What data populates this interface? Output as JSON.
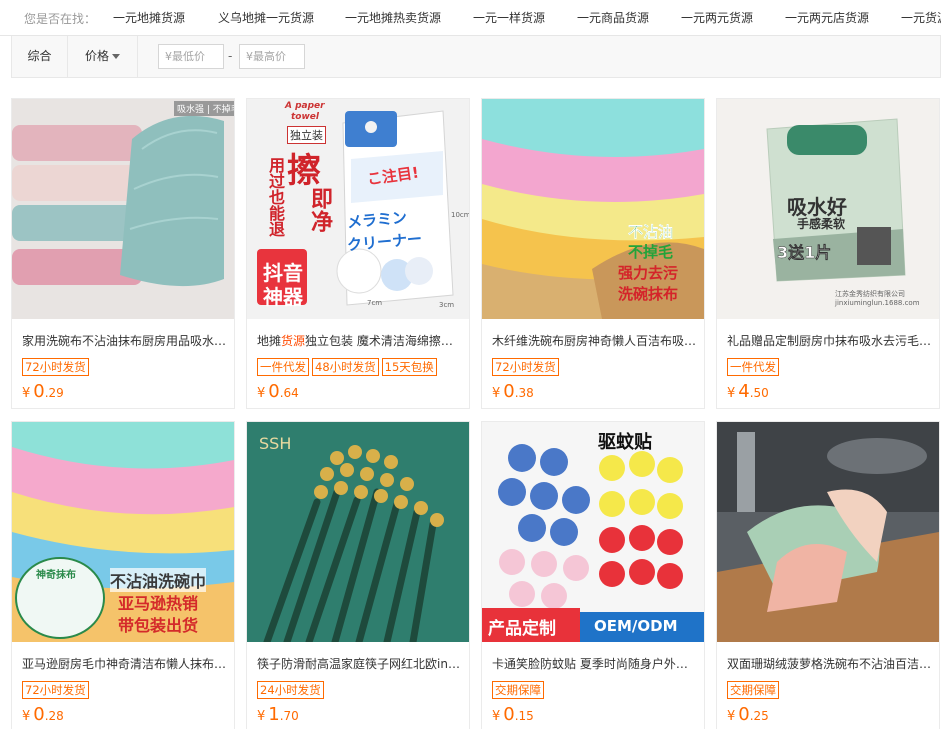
{
  "suggestions": {
    "label": "您是否在找：",
    "terms": [
      "一元地摊货源",
      "义乌地摊一元货源",
      "一元地摊热卖货源",
      "一元一样货源",
      "一元商品货源",
      "一元两元货源",
      "一元两元店货源",
      "一元货源"
    ]
  },
  "filter": {
    "sort_default": "综合",
    "sort_price": "价格",
    "min_price_placeholder": "¥最低价",
    "max_price_placeholder": "¥最高价",
    "separator": "-"
  },
  "products": [
    {
      "title": "家用洗碗布不沾油抹布厨房用品吸水…",
      "title_pre": "",
      "title_hl": "",
      "title_post": "",
      "tags": [
        "72小时发货"
      ],
      "currency": "¥",
      "price_int": "0",
      "price_dec": ".29",
      "image_text": [
        "吸水强 | 不掉毛"
      ]
    },
    {
      "title": "",
      "title_pre": "地摊",
      "title_hl": "货源",
      "title_post": "独立包装 魔术清洁海绵擦…",
      "tags": [
        "一件代发",
        "48小时发货",
        "15天包换"
      ],
      "currency": "¥",
      "price_int": "0",
      "price_dec": ".64",
      "image_text": [
        "A paper",
        "towel",
        "独立装",
        "擦",
        "即净",
        "用过也能退",
        "抖音",
        "神器",
        "こ注目!",
        "メラミン",
        "クリーナー",
        "10cm",
        "7cm",
        "3cm"
      ]
    },
    {
      "title": "木纤维洗碗布厨房神奇懒人百洁布吸…",
      "title_pre": "",
      "title_hl": "",
      "title_post": "",
      "tags": [
        "72小时发货"
      ],
      "currency": "¥",
      "price_int": "0",
      "price_dec": ".38",
      "image_text": [
        "不沾油",
        "不掉毛",
        "强力去污",
        "洗碗抹布"
      ]
    },
    {
      "title": "礼品赠品定制厨房巾抹布吸水去污毛…",
      "title_pre": "",
      "title_hl": "",
      "title_post": "",
      "tags": [
        "一件代发"
      ],
      "currency": "¥",
      "price_int": "4",
      "price_dec": ".50",
      "image_text": [
        "吸水好",
        "手感柔软",
        "3送1片",
        "江苏金秀纺织有限公司",
        "jinxiuminglun.1688.com"
      ]
    },
    {
      "title": "亚马逊厨房毛巾神奇清洁布懒人抹布…",
      "title_pre": "",
      "title_hl": "",
      "title_post": "",
      "tags": [
        "72小时发货"
      ],
      "currency": "¥",
      "price_int": "0",
      "price_dec": ".28",
      "image_text": [
        "不沾油洗碗巾",
        "亚马逊热销",
        "带包装出货",
        "神奇抹布"
      ]
    },
    {
      "title": "筷子防滑耐高温家庭筷子网红北欧in…",
      "title_pre": "",
      "title_hl": "",
      "title_post": "",
      "tags": [
        "24小时发货"
      ],
      "currency": "¥",
      "price_int": "1",
      "price_dec": ".70",
      "image_text": [
        "SSH"
      ]
    },
    {
      "title": "卡通笑脸防蚊贴 夏季时尚随身户外…",
      "title_pre": "",
      "title_hl": "",
      "title_post": "",
      "tags": [
        "交期保障"
      ],
      "currency": "¥",
      "price_int": "0",
      "price_dec": ".15",
      "image_text": [
        "驱蚊贴",
        "产品定制",
        "OEM/ODM"
      ]
    },
    {
      "title": "双面珊瑚绒菠萝格洗碗布不沾油百洁…",
      "title_pre": "",
      "title_hl": "",
      "title_post": "",
      "tags": [
        "交期保障"
      ],
      "currency": "¥",
      "price_int": "0",
      "price_dec": ".25",
      "image_text": []
    }
  ],
  "colors": {
    "accent": "#ff6a00",
    "highlight": "#ff4a00"
  }
}
